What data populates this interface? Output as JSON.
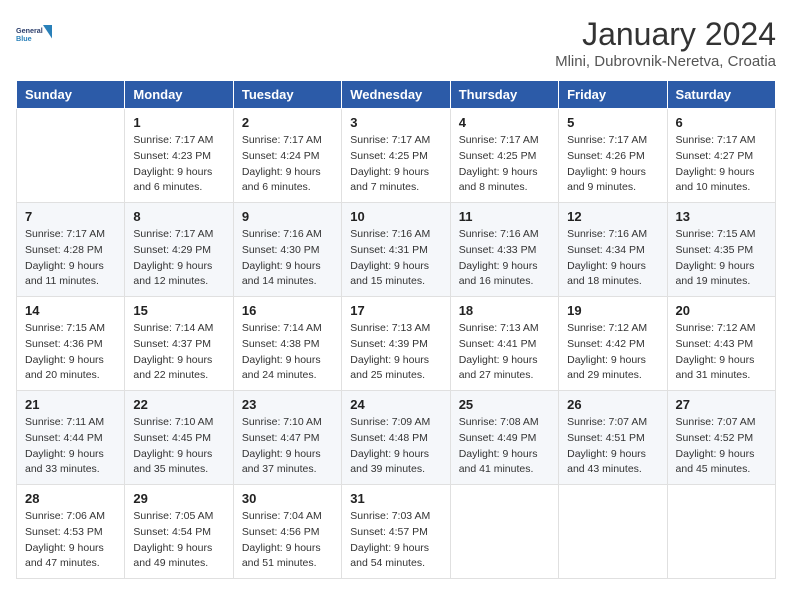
{
  "logo": {
    "line1": "General",
    "line2": "Blue"
  },
  "title": "January 2024",
  "location": "Mlini, Dubrovnik-Neretva, Croatia",
  "weekdays": [
    "Sunday",
    "Monday",
    "Tuesday",
    "Wednesday",
    "Thursday",
    "Friday",
    "Saturday"
  ],
  "weeks": [
    [
      null,
      {
        "day": 1,
        "sunrise": "7:17 AM",
        "sunset": "4:23 PM",
        "daylight": "9 hours and 6 minutes."
      },
      {
        "day": 2,
        "sunrise": "7:17 AM",
        "sunset": "4:24 PM",
        "daylight": "9 hours and 6 minutes."
      },
      {
        "day": 3,
        "sunrise": "7:17 AM",
        "sunset": "4:25 PM",
        "daylight": "9 hours and 7 minutes."
      },
      {
        "day": 4,
        "sunrise": "7:17 AM",
        "sunset": "4:25 PM",
        "daylight": "9 hours and 8 minutes."
      },
      {
        "day": 5,
        "sunrise": "7:17 AM",
        "sunset": "4:26 PM",
        "daylight": "9 hours and 9 minutes."
      },
      {
        "day": 6,
        "sunrise": "7:17 AM",
        "sunset": "4:27 PM",
        "daylight": "9 hours and 10 minutes."
      }
    ],
    [
      {
        "day": 7,
        "sunrise": "7:17 AM",
        "sunset": "4:28 PM",
        "daylight": "9 hours and 11 minutes."
      },
      {
        "day": 8,
        "sunrise": "7:17 AM",
        "sunset": "4:29 PM",
        "daylight": "9 hours and 12 minutes."
      },
      {
        "day": 9,
        "sunrise": "7:16 AM",
        "sunset": "4:30 PM",
        "daylight": "9 hours and 14 minutes."
      },
      {
        "day": 10,
        "sunrise": "7:16 AM",
        "sunset": "4:31 PM",
        "daylight": "9 hours and 15 minutes."
      },
      {
        "day": 11,
        "sunrise": "7:16 AM",
        "sunset": "4:33 PM",
        "daylight": "9 hours and 16 minutes."
      },
      {
        "day": 12,
        "sunrise": "7:16 AM",
        "sunset": "4:34 PM",
        "daylight": "9 hours and 18 minutes."
      },
      {
        "day": 13,
        "sunrise": "7:15 AM",
        "sunset": "4:35 PM",
        "daylight": "9 hours and 19 minutes."
      }
    ],
    [
      {
        "day": 14,
        "sunrise": "7:15 AM",
        "sunset": "4:36 PM",
        "daylight": "9 hours and 20 minutes."
      },
      {
        "day": 15,
        "sunrise": "7:14 AM",
        "sunset": "4:37 PM",
        "daylight": "9 hours and 22 minutes."
      },
      {
        "day": 16,
        "sunrise": "7:14 AM",
        "sunset": "4:38 PM",
        "daylight": "9 hours and 24 minutes."
      },
      {
        "day": 17,
        "sunrise": "7:13 AM",
        "sunset": "4:39 PM",
        "daylight": "9 hours and 25 minutes."
      },
      {
        "day": 18,
        "sunrise": "7:13 AM",
        "sunset": "4:41 PM",
        "daylight": "9 hours and 27 minutes."
      },
      {
        "day": 19,
        "sunrise": "7:12 AM",
        "sunset": "4:42 PM",
        "daylight": "9 hours and 29 minutes."
      },
      {
        "day": 20,
        "sunrise": "7:12 AM",
        "sunset": "4:43 PM",
        "daylight": "9 hours and 31 minutes."
      }
    ],
    [
      {
        "day": 21,
        "sunrise": "7:11 AM",
        "sunset": "4:44 PM",
        "daylight": "9 hours and 33 minutes."
      },
      {
        "day": 22,
        "sunrise": "7:10 AM",
        "sunset": "4:45 PM",
        "daylight": "9 hours and 35 minutes."
      },
      {
        "day": 23,
        "sunrise": "7:10 AM",
        "sunset": "4:47 PM",
        "daylight": "9 hours and 37 minutes."
      },
      {
        "day": 24,
        "sunrise": "7:09 AM",
        "sunset": "4:48 PM",
        "daylight": "9 hours and 39 minutes."
      },
      {
        "day": 25,
        "sunrise": "7:08 AM",
        "sunset": "4:49 PM",
        "daylight": "9 hours and 41 minutes."
      },
      {
        "day": 26,
        "sunrise": "7:07 AM",
        "sunset": "4:51 PM",
        "daylight": "9 hours and 43 minutes."
      },
      {
        "day": 27,
        "sunrise": "7:07 AM",
        "sunset": "4:52 PM",
        "daylight": "9 hours and 45 minutes."
      }
    ],
    [
      {
        "day": 28,
        "sunrise": "7:06 AM",
        "sunset": "4:53 PM",
        "daylight": "9 hours and 47 minutes."
      },
      {
        "day": 29,
        "sunrise": "7:05 AM",
        "sunset": "4:54 PM",
        "daylight": "9 hours and 49 minutes."
      },
      {
        "day": 30,
        "sunrise": "7:04 AM",
        "sunset": "4:56 PM",
        "daylight": "9 hours and 51 minutes."
      },
      {
        "day": 31,
        "sunrise": "7:03 AM",
        "sunset": "4:57 PM",
        "daylight": "9 hours and 54 minutes."
      },
      null,
      null,
      null
    ]
  ]
}
